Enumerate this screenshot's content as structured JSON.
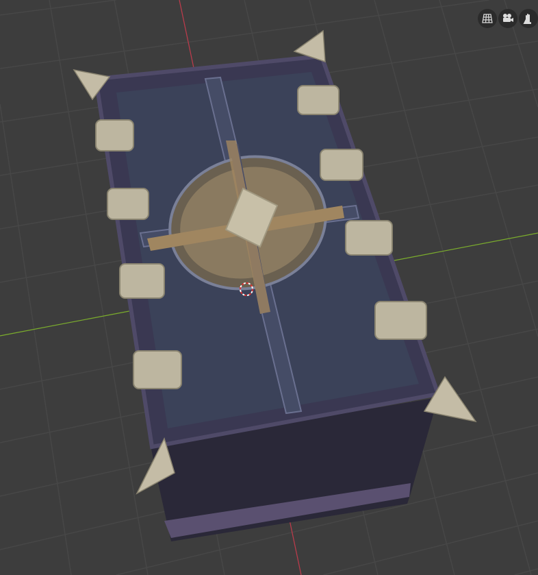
{
  "viewport": {
    "background_color": "#3d3d3d",
    "grid_color": "#4a4a4a",
    "x_axis_color": "#c0394a",
    "y_axis_color": "#7bae2a"
  },
  "nav_gizmo": {
    "buttons": [
      {
        "icon": "grid-perspective-icon"
      },
      {
        "icon": "camera-icon"
      },
      {
        "icon": "hand-pan-icon"
      }
    ]
  },
  "scene": {
    "object": "ornate-book-chest",
    "cover_color": "#353a55",
    "metal_color": "#b5ad95",
    "gold_color": "#a88a55"
  }
}
